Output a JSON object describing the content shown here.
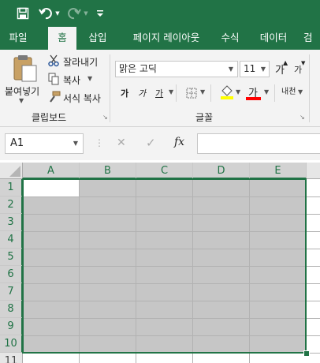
{
  "quick_access": {
    "save_icon": "save-icon",
    "undo_icon": "undo-icon",
    "redo_icon": "redo-icon",
    "customize_icon": "customize-qat-icon"
  },
  "tabs": [
    {
      "label": "파일"
    },
    {
      "label": "홈",
      "active": true
    },
    {
      "label": "삽입"
    },
    {
      "label": "페이지 레이아웃"
    },
    {
      "label": "수식"
    },
    {
      "label": "데이터"
    },
    {
      "label": "검"
    }
  ],
  "clipboard": {
    "paste_label": "붙여넣기",
    "cut_label": "잘라내기",
    "copy_label": "복사",
    "format_painter_label": "서식 복사",
    "group_label": "클립보드"
  },
  "font": {
    "font_name": "맑은 고딕",
    "font_size": "11",
    "grow_label": "가",
    "shrink_label": "가",
    "bold_label": "가",
    "italic_label": "가",
    "underline_label": "가",
    "font_color_label": "가",
    "phonetic_label": "내천",
    "group_label": "글꼴",
    "fill_color": "#FFFF00",
    "font_color": "#FF0000"
  },
  "formula_bar": {
    "name_box": "A1",
    "cancel": "✕",
    "enter": "✓",
    "fx": "fx",
    "formula": ""
  },
  "sheet": {
    "columns": [
      "A",
      "B",
      "C",
      "D",
      "E"
    ],
    "rows": [
      "1",
      "2",
      "3",
      "4",
      "5",
      "6",
      "7",
      "8",
      "9",
      "10",
      "11"
    ],
    "active_cell": "A1",
    "selection": "A1:E10",
    "accent": "#217346"
  }
}
